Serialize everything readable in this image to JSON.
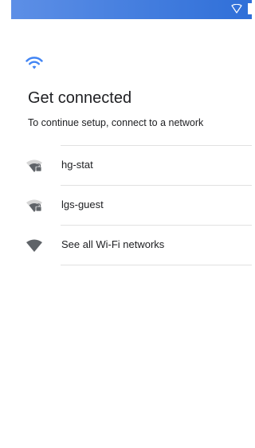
{
  "status_bar": {
    "wifi_icon": "wifi-outline-icon",
    "battery_icon": "battery-icon",
    "accent": "#2f6fd8"
  },
  "header": {
    "icon": "wifi-icon",
    "icon_color": "#4285f4",
    "title": "Get connected",
    "subtitle": "To continue setup, connect to a network"
  },
  "networks": [
    {
      "name": "hg-stat",
      "icon": "wifi-locked-icon"
    },
    {
      "name": "lgs-guest",
      "icon": "wifi-locked-icon"
    },
    {
      "name": "See all Wi-Fi networks",
      "icon": "wifi-full-icon"
    }
  ]
}
